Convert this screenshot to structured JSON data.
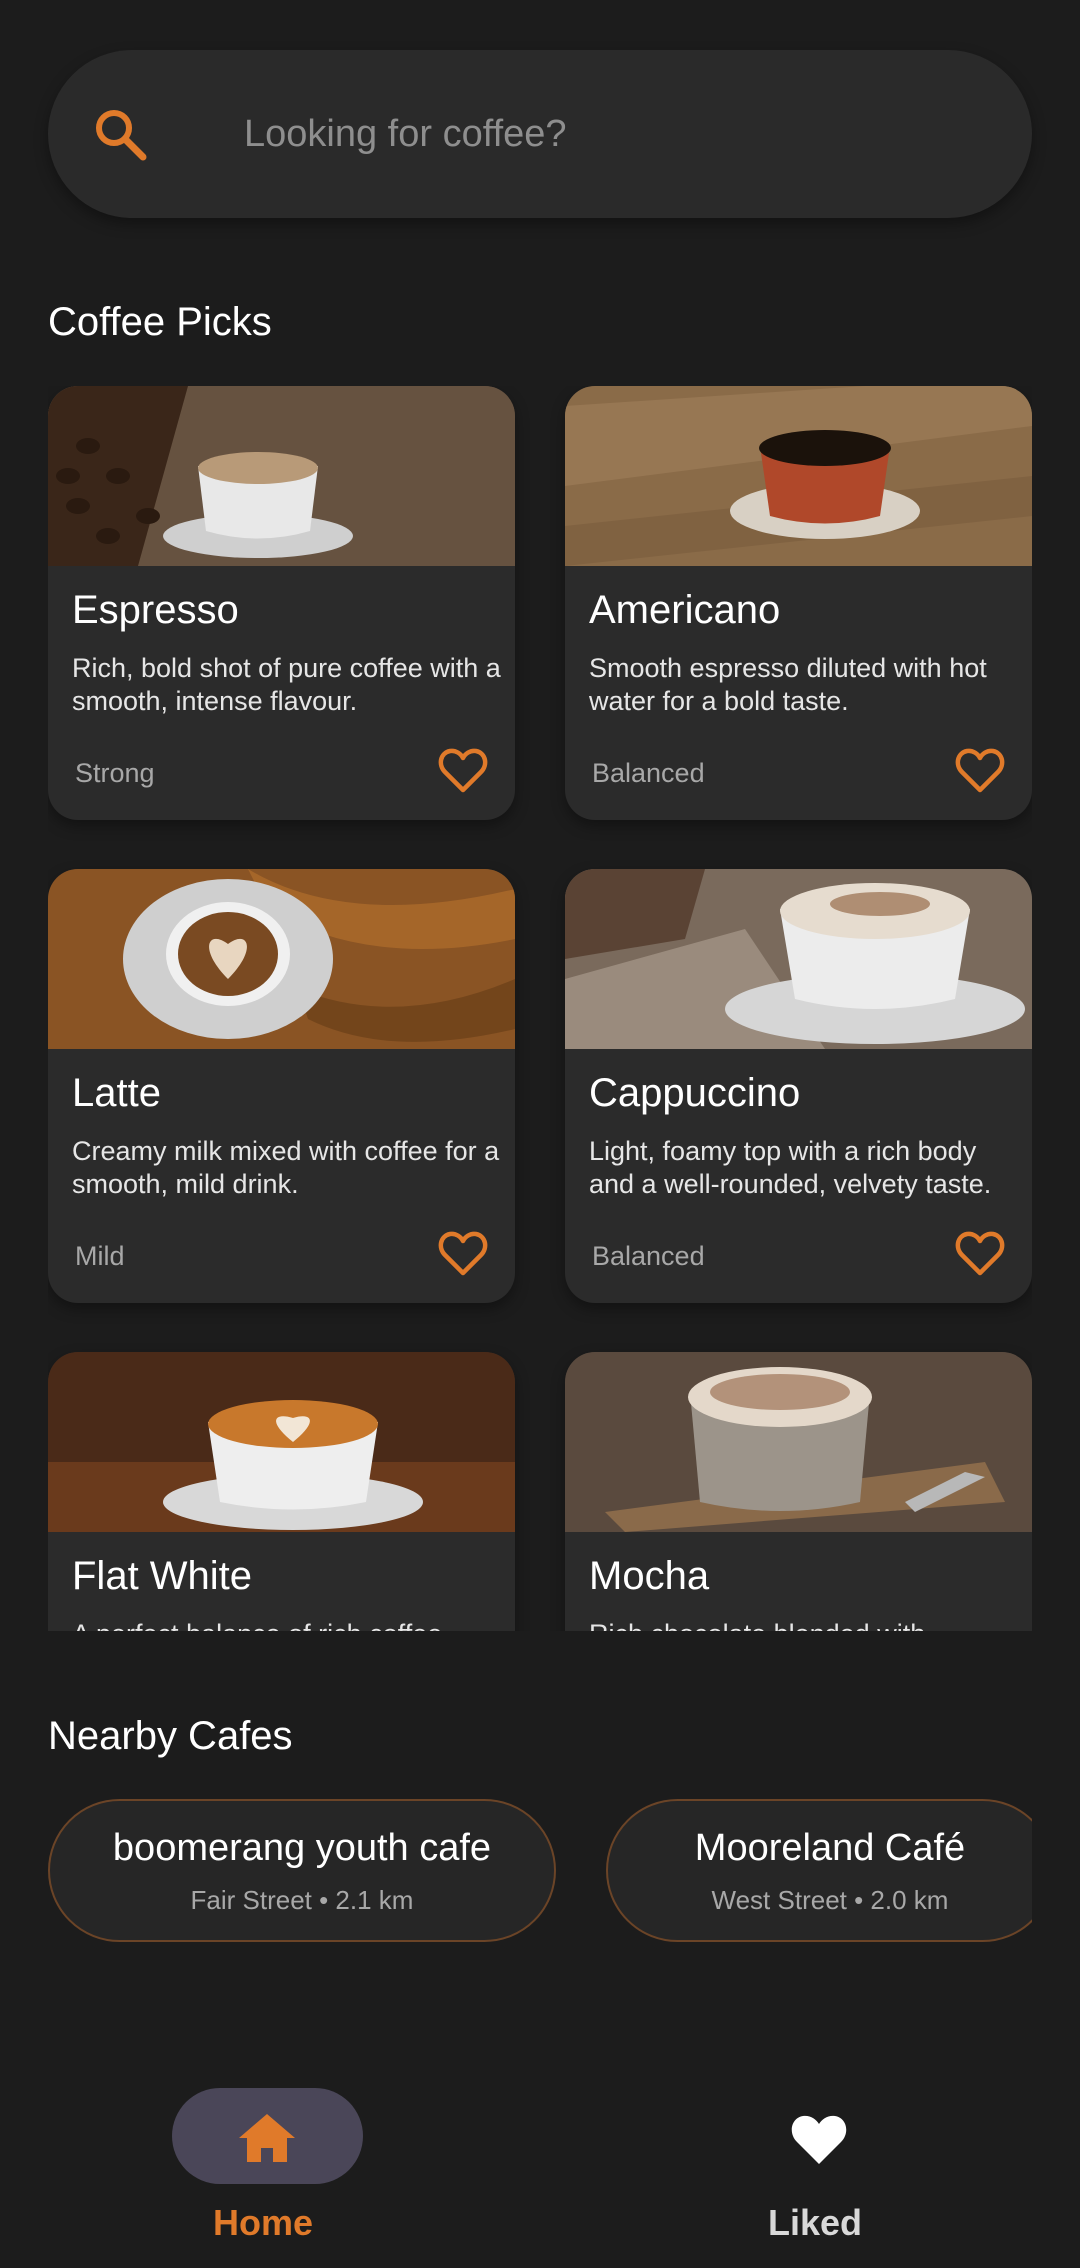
{
  "colors": {
    "accent": "#e07a2a",
    "background": "#1c1c1c",
    "card": "#2b2b2b",
    "pill": "#4a4658"
  },
  "search": {
    "placeholder": "Looking for coffee?",
    "icon": "search-icon"
  },
  "coffee_picks": {
    "title": "Coffee Picks",
    "items": [
      {
        "name": "Espresso",
        "description": "Rich, bold shot of pure coffee with a smooth, intense flavour.",
        "strength": "Strong",
        "icon": "heart-outline-icon"
      },
      {
        "name": "Americano",
        "description": "Smooth espresso diluted with hot water for a bold taste.",
        "strength": "Balanced",
        "icon": "heart-outline-icon"
      },
      {
        "name": "Latte",
        "description": "Creamy milk mixed with coffee for a smooth, mild drink.",
        "strength": "Mild",
        "icon": "heart-outline-icon"
      },
      {
        "name": "Cappuccino",
        "description": "Light, foamy top with a rich body and a well-rounded, velvety taste.",
        "strength": "Balanced",
        "icon": "heart-outline-icon"
      },
      {
        "name": "Flat White",
        "description": "A perfect balance of rich coffee",
        "strength": "",
        "icon": "heart-outline-icon"
      },
      {
        "name": "Mocha",
        "description": "Rich chocolate blended with",
        "strength": "",
        "icon": "heart-outline-icon"
      }
    ]
  },
  "nearby_cafes": {
    "title": "Nearby Cafes",
    "items": [
      {
        "name": "boomerang youth cafe",
        "meta": "Fair Street • 2.1 km"
      },
      {
        "name": "Mooreland Café",
        "meta": "West Street • 2.0 km"
      }
    ]
  },
  "bottom_nav": {
    "items": [
      {
        "label": "Home",
        "icon": "home-icon",
        "active": true
      },
      {
        "label": "Liked",
        "icon": "heart-filled-icon",
        "active": false
      }
    ]
  }
}
